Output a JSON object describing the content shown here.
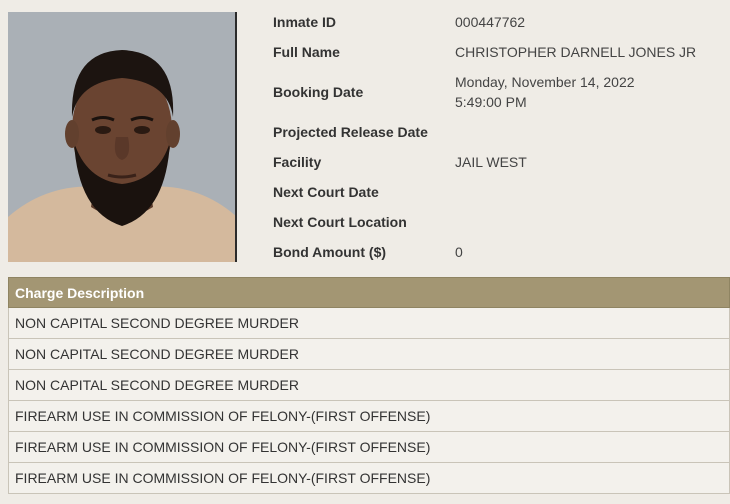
{
  "inmate": {
    "fields": [
      {
        "label": "Inmate ID",
        "value": "000447762"
      },
      {
        "label": "Full Name",
        "value": "CHRISTOPHER DARNELL JONES JR"
      },
      {
        "label": "Booking Date",
        "value": "Monday, November 14, 2022",
        "value2": "5:49:00 PM"
      },
      {
        "label": "Projected Release Date",
        "value": ""
      },
      {
        "label": "Facility",
        "value": "JAIL WEST"
      },
      {
        "label": "Next Court Date",
        "value": ""
      },
      {
        "label": "Next Court Location",
        "value": ""
      },
      {
        "label": "Bond Amount ($)",
        "value": "0"
      }
    ]
  },
  "charges": {
    "header": "Charge Description",
    "rows": [
      "NON CAPITAL SECOND DEGREE MURDER",
      "NON CAPITAL SECOND DEGREE MURDER",
      "NON CAPITAL SECOND DEGREE MURDER",
      "FIREARM USE IN COMMISSION OF FELONY-(FIRST OFFENSE)",
      "FIREARM USE IN COMMISSION OF FELONY-(FIRST OFFENSE)",
      "FIREARM USE IN COMMISSION OF FELONY-(FIRST OFFENSE)"
    ]
  },
  "colors": {
    "header_bg": "#a39673",
    "page_bg": "#efece6"
  },
  "icons": {
    "photo": "inmate-photo-icon"
  }
}
